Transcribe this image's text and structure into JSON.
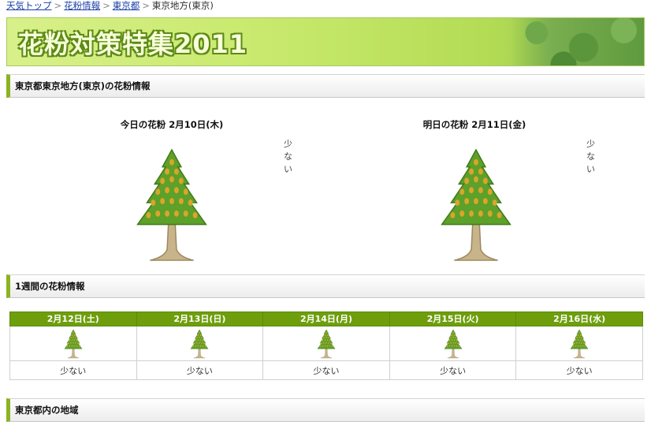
{
  "breadcrumb": {
    "items": [
      "天気トップ",
      "花粉情報",
      "東京都"
    ],
    "current": "東京地方(東京)",
    "separator": ">"
  },
  "banner": {
    "title": "花粉対策特集2011"
  },
  "sections": {
    "region": "東京都東京地方(東京)の花粉情報",
    "weekly": "1週間の花粉情報",
    "areas": "東京都内の地域"
  },
  "today": {
    "title": "今日の花粉 2月10日(木)",
    "level": "少ない",
    "icon": "pollen-tree-icon"
  },
  "tomorrow": {
    "title": "明日の花粉 2月11日(金)",
    "level": "少ない",
    "icon": "pollen-tree-icon"
  },
  "weekly": {
    "days": [
      {
        "date": "2月12日(土)",
        "level": "少ない"
      },
      {
        "date": "2月13日(日)",
        "level": "少ない"
      },
      {
        "date": "2月14日(月)",
        "level": "少ない"
      },
      {
        "date": "2月15日(火)",
        "level": "少ない"
      },
      {
        "date": "2月16日(水)",
        "level": "少ない"
      }
    ]
  },
  "colors": {
    "accent": "#8cb321",
    "table_header": "#6f9e0d",
    "link": "#1a3fa8"
  }
}
